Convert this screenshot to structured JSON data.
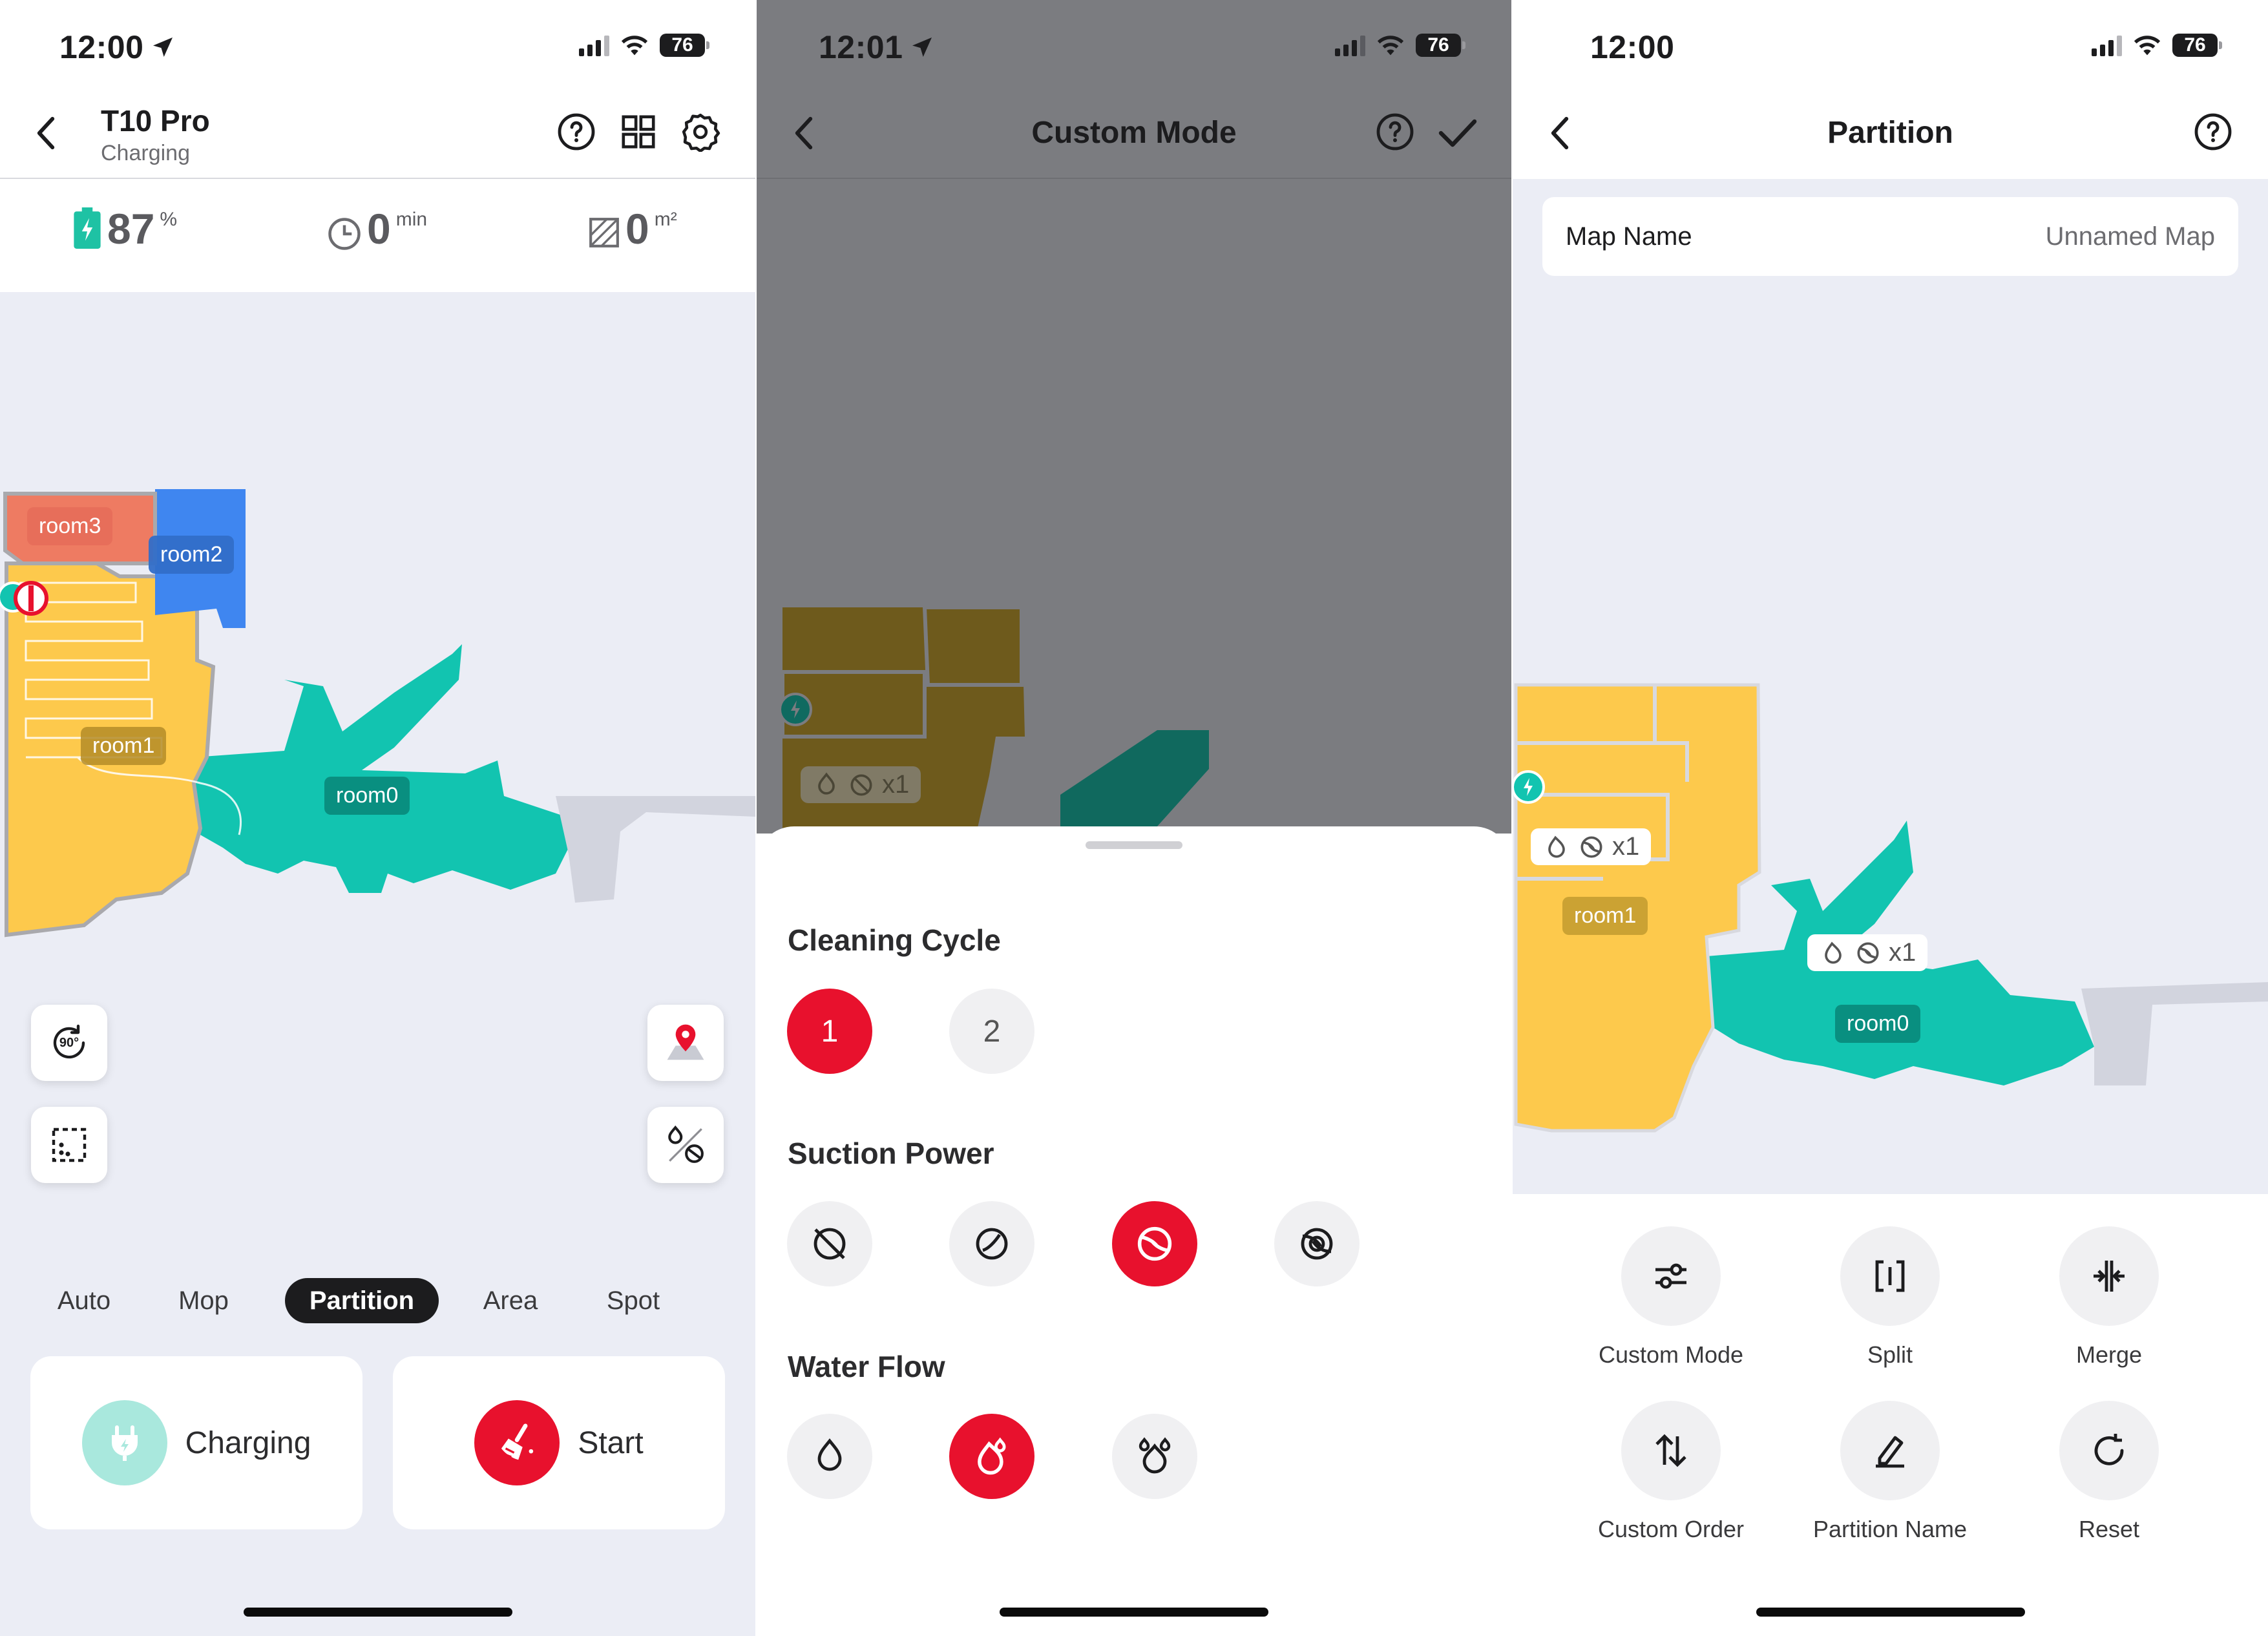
{
  "screen1": {
    "status": {
      "time": "12:00",
      "battery": "76"
    },
    "header": {
      "title": "T10 Pro",
      "subtitle": "Charging"
    },
    "stats": {
      "battery_value": "87",
      "battery_unit": "%",
      "time_value": "0",
      "time_unit": "min",
      "area_value": "0",
      "area_unit": "m²"
    },
    "map_labels": {
      "room3": "room3",
      "room2": "room2",
      "room1": "room1",
      "room0": "room0"
    },
    "rotate_label": "90°",
    "modes": [
      "Auto",
      "Mop",
      "Partition",
      "Area",
      "Spot"
    ],
    "active_mode": "Partition",
    "actions": {
      "charging": "Charging",
      "start": "Start"
    }
  },
  "screen2": {
    "status": {
      "time": "12:01",
      "battery": "76"
    },
    "header": {
      "title": "Custom Mode"
    },
    "map_badge_count": "x1",
    "cleaning_cycle": {
      "title": "Cleaning Cycle",
      "options": [
        "1",
        "2"
      ],
      "selected": "1"
    },
    "suction_power": {
      "title": "Suction Power",
      "options": [
        "off-icon",
        "quiet-icon",
        "standard-icon",
        "max-icon"
      ],
      "selected_index": 2
    },
    "water_flow": {
      "title": "Water Flow",
      "options": [
        "low-icon",
        "medium-icon",
        "high-icon"
      ],
      "selected_index": 1
    }
  },
  "screen3": {
    "status": {
      "time": "12:00",
      "battery": "76"
    },
    "header": {
      "title": "Partition"
    },
    "map_name": {
      "label": "Map Name",
      "value": "Unnamed Map"
    },
    "map_labels": {
      "room1": "room1",
      "room0": "room0"
    },
    "badge_counts": [
      "x1",
      "x1"
    ],
    "tools": [
      {
        "label": "Custom Mode",
        "icon": "sliders-icon"
      },
      {
        "label": "Split",
        "icon": "split-icon"
      },
      {
        "label": "Merge",
        "icon": "merge-icon"
      },
      {
        "label": "Custom Order",
        "icon": "sort-arrows-icon"
      },
      {
        "label": "Partition Name",
        "icon": "pencil-icon"
      },
      {
        "label": "Reset",
        "icon": "reset-icon"
      }
    ]
  },
  "colors": {
    "accent_red": "#e8112d",
    "teal": "#12c4b0",
    "room_yellow": "#fdc94c",
    "room_blue": "#3f86f0",
    "room_salmon": "#ee7b62",
    "map_background": "#ebedf5"
  }
}
